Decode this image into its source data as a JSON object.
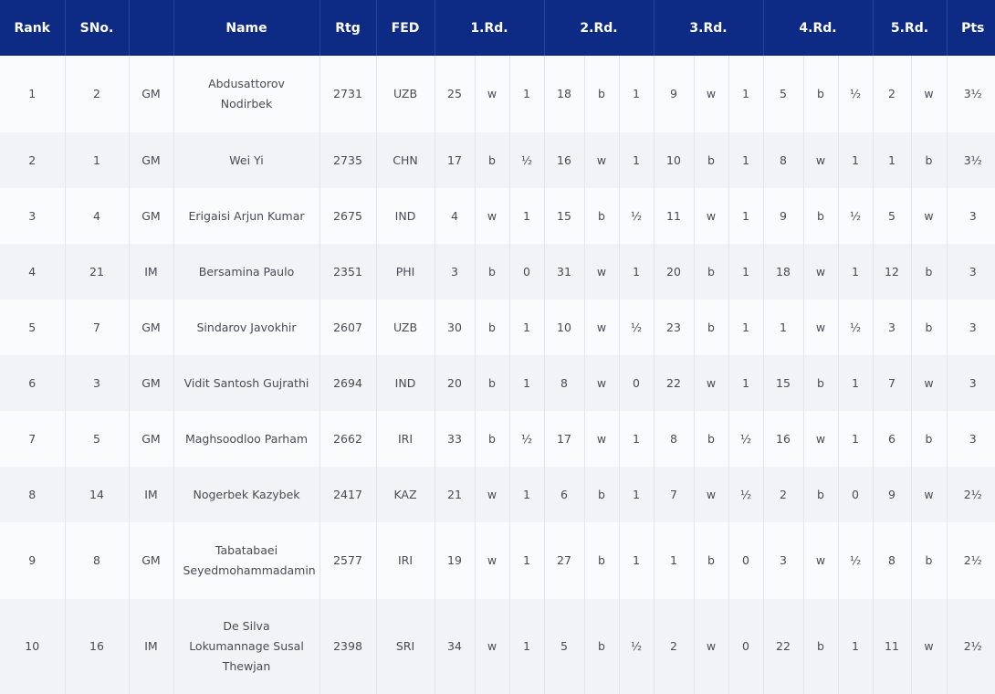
{
  "table": {
    "headers": {
      "rank": "Rank",
      "sno": "SNo.",
      "title": "",
      "name": "Name",
      "rtg": "Rtg",
      "fed": "FED",
      "rd1": "1.Rd.",
      "rd2": "2.Rd.",
      "rd3": "3.Rd.",
      "rd4": "4.Rd.",
      "rd5": "5.Rd.",
      "pts": "Pts"
    },
    "rows": [
      {
        "rank": "1",
        "sno": "2",
        "title": "GM",
        "name": "Abdusattorov Nodirbek",
        "rtg": "2731",
        "fed": "UZB",
        "rounds": [
          {
            "opp": "25",
            "color": "w",
            "res": "1"
          },
          {
            "opp": "18",
            "color": "b",
            "res": "1"
          },
          {
            "opp": "9",
            "color": "w",
            "res": "1"
          },
          {
            "opp": "5",
            "color": "b",
            "res": "½"
          },
          {
            "opp": "2",
            "color": "w",
            "res": ""
          }
        ],
        "pts": "3½"
      },
      {
        "rank": "2",
        "sno": "1",
        "title": "GM",
        "name": "Wei Yi",
        "rtg": "2735",
        "fed": "CHN",
        "rounds": [
          {
            "opp": "17",
            "color": "b",
            "res": "½"
          },
          {
            "opp": "16",
            "color": "w",
            "res": "1"
          },
          {
            "opp": "10",
            "color": "b",
            "res": "1"
          },
          {
            "opp": "8",
            "color": "w",
            "res": "1"
          },
          {
            "opp": "1",
            "color": "b",
            "res": ""
          }
        ],
        "pts": "3½"
      },
      {
        "rank": "3",
        "sno": "4",
        "title": "GM",
        "name": "Erigaisi Arjun Kumar",
        "rtg": "2675",
        "fed": "IND",
        "rounds": [
          {
            "opp": "4",
            "color": "w",
            "res": "1"
          },
          {
            "opp": "15",
            "color": "b",
            "res": "½"
          },
          {
            "opp": "11",
            "color": "w",
            "res": "1"
          },
          {
            "opp": "9",
            "color": "b",
            "res": "½"
          },
          {
            "opp": "5",
            "color": "w",
            "res": ""
          }
        ],
        "pts": "3"
      },
      {
        "rank": "4",
        "sno": "21",
        "title": "IM",
        "name": "Bersamina Paulo",
        "rtg": "2351",
        "fed": "PHI",
        "rounds": [
          {
            "opp": "3",
            "color": "b",
            "res": "0"
          },
          {
            "opp": "31",
            "color": "w",
            "res": "1"
          },
          {
            "opp": "20",
            "color": "b",
            "res": "1"
          },
          {
            "opp": "18",
            "color": "w",
            "res": "1"
          },
          {
            "opp": "12",
            "color": "b",
            "res": ""
          }
        ],
        "pts": "3"
      },
      {
        "rank": "5",
        "sno": "7",
        "title": "GM",
        "name": "Sindarov Javokhir",
        "rtg": "2607",
        "fed": "UZB",
        "rounds": [
          {
            "opp": "30",
            "color": "b",
            "res": "1"
          },
          {
            "opp": "10",
            "color": "w",
            "res": "½"
          },
          {
            "opp": "23",
            "color": "b",
            "res": "1"
          },
          {
            "opp": "1",
            "color": "w",
            "res": "½"
          },
          {
            "opp": "3",
            "color": "b",
            "res": ""
          }
        ],
        "pts": "3"
      },
      {
        "rank": "6",
        "sno": "3",
        "title": "GM",
        "name": "Vidit Santosh Gujrathi",
        "rtg": "2694",
        "fed": "IND",
        "rounds": [
          {
            "opp": "20",
            "color": "b",
            "res": "1"
          },
          {
            "opp": "8",
            "color": "w",
            "res": "0"
          },
          {
            "opp": "22",
            "color": "w",
            "res": "1"
          },
          {
            "opp": "15",
            "color": "b",
            "res": "1"
          },
          {
            "opp": "7",
            "color": "w",
            "res": ""
          }
        ],
        "pts": "3"
      },
      {
        "rank": "7",
        "sno": "5",
        "title": "GM",
        "name": "Maghsoodloo Parham",
        "rtg": "2662",
        "fed": "IRI",
        "rounds": [
          {
            "opp": "33",
            "color": "b",
            "res": "½"
          },
          {
            "opp": "17",
            "color": "w",
            "res": "1"
          },
          {
            "opp": "8",
            "color": "b",
            "res": "½"
          },
          {
            "opp": "16",
            "color": "w",
            "res": "1"
          },
          {
            "opp": "6",
            "color": "b",
            "res": ""
          }
        ],
        "pts": "3"
      },
      {
        "rank": "8",
        "sno": "14",
        "title": "IM",
        "name": "Nogerbek Kazybek",
        "rtg": "2417",
        "fed": "KAZ",
        "rounds": [
          {
            "opp": "21",
            "color": "w",
            "res": "1"
          },
          {
            "opp": "6",
            "color": "b",
            "res": "1"
          },
          {
            "opp": "7",
            "color": "w",
            "res": "½"
          },
          {
            "opp": "2",
            "color": "b",
            "res": "0"
          },
          {
            "opp": "9",
            "color": "w",
            "res": ""
          }
        ],
        "pts": "2½"
      },
      {
        "rank": "9",
        "sno": "8",
        "title": "GM",
        "name": "Tabatabaei Seyedmohammadamin",
        "rtg": "2577",
        "fed": "IRI",
        "rounds": [
          {
            "opp": "19",
            "color": "w",
            "res": "1"
          },
          {
            "opp": "27",
            "color": "b",
            "res": "1"
          },
          {
            "opp": "1",
            "color": "b",
            "res": "0"
          },
          {
            "opp": "3",
            "color": "w",
            "res": "½"
          },
          {
            "opp": "8",
            "color": "b",
            "res": ""
          }
        ],
        "pts": "2½"
      },
      {
        "rank": "10",
        "sno": "16",
        "title": "IM",
        "name": "De Silva Lokumannage Susal Thewjan",
        "rtg": "2398",
        "fed": "SRI",
        "rounds": [
          {
            "opp": "34",
            "color": "w",
            "res": "1"
          },
          {
            "opp": "5",
            "color": "b",
            "res": "½"
          },
          {
            "opp": "2",
            "color": "w",
            "res": "0"
          },
          {
            "opp": "22",
            "color": "b",
            "res": "1"
          },
          {
            "opp": "11",
            "color": "w",
            "res": ""
          }
        ],
        "pts": "2½"
      }
    ]
  }
}
